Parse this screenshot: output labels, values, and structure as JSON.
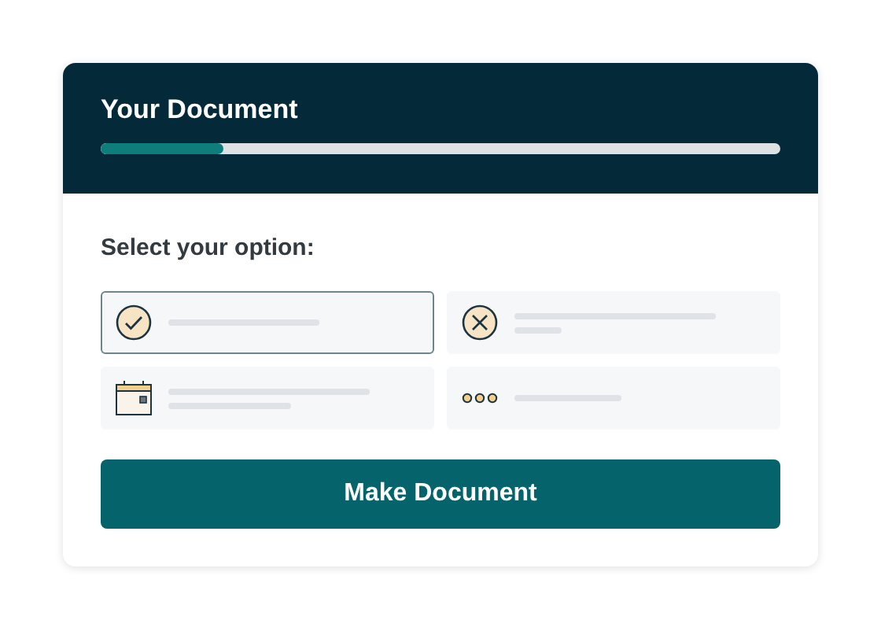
{
  "header": {
    "title": "Your Document",
    "progress": {
      "level": 0.18
    }
  },
  "prompt": "Select your option:",
  "options": [
    {
      "kind": "check",
      "selected": true
    },
    {
      "kind": "cross",
      "selected": false
    },
    {
      "kind": "calendar",
      "selected": false
    },
    {
      "kind": "dots",
      "selected": false
    }
  ],
  "button": "Make Document"
}
